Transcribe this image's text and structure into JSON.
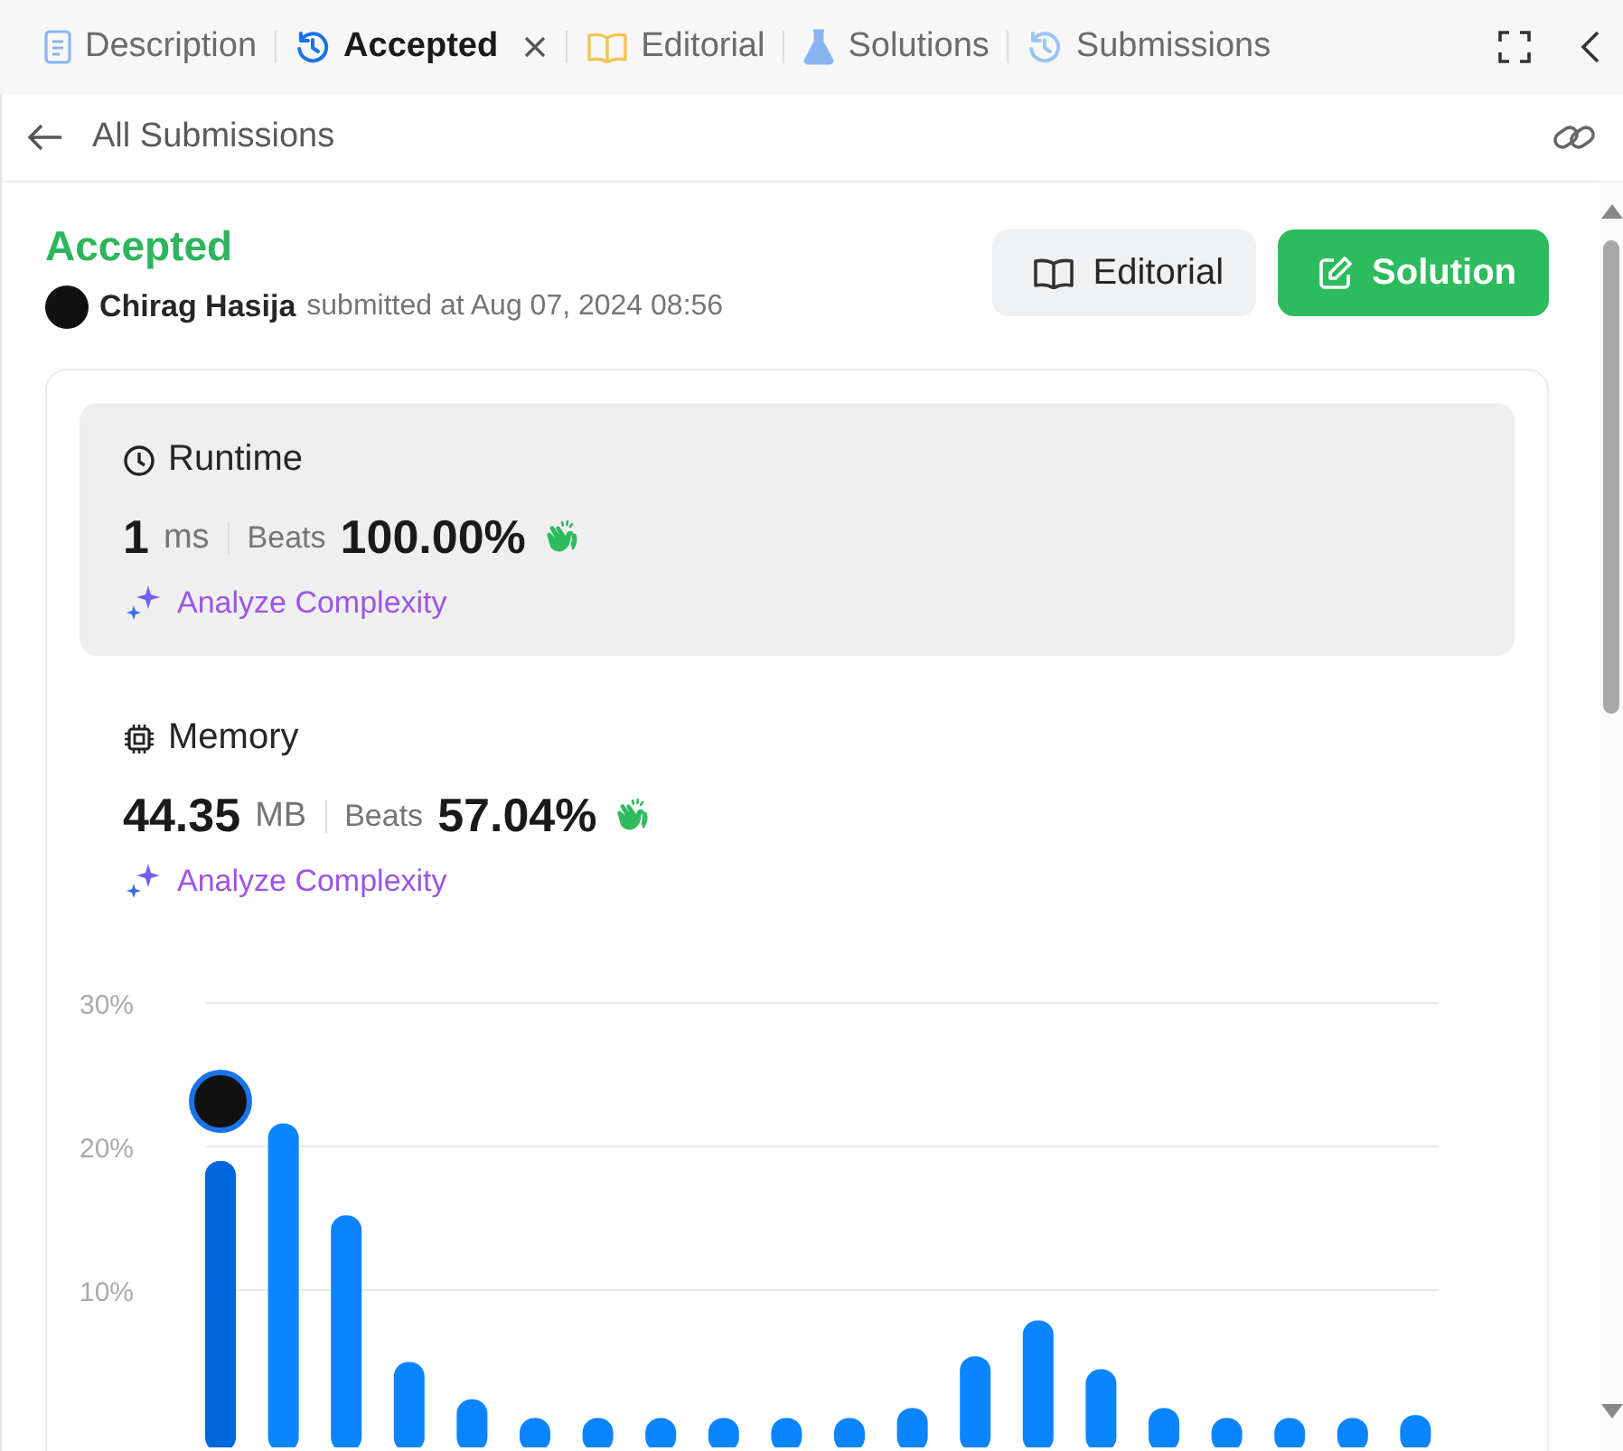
{
  "tabs": [
    {
      "label": "Description",
      "kind": "doc",
      "selected": false,
      "closable": false
    },
    {
      "label": "Accepted",
      "kind": "history",
      "selected": true,
      "closable": true
    },
    {
      "label": "Editorial",
      "kind": "book",
      "selected": false,
      "closable": false
    },
    {
      "label": "Solutions",
      "kind": "flask",
      "selected": false,
      "closable": false
    },
    {
      "label": "Submissions",
      "kind": "history",
      "selected": false,
      "closable": false
    }
  ],
  "back_link": "All Submissions",
  "submission": {
    "status": "Accepted",
    "author": "Chirag Hasija",
    "submitted_text": "submitted at Aug 07, 2024 08:56"
  },
  "buttons": [
    {
      "label": "Editorial",
      "kind": "secondary"
    },
    {
      "label": "Solution",
      "kind": "primary"
    }
  ],
  "metrics": [
    {
      "title": "Runtime",
      "kind": "clock",
      "value": "1",
      "unit": "ms",
      "beats_label": "Beats",
      "beats": "100.00%",
      "analyze": "Analyze Complexity",
      "selected": true
    },
    {
      "title": "Memory",
      "kind": "chip",
      "value": "44.35",
      "unit": "MB",
      "beats_label": "Beats",
      "beats": "57.04%",
      "analyze": "Analyze Complexity",
      "selected": false
    }
  ],
  "distribution": {
    "chart_data": {
      "type": "bar",
      "ylim": [
        0,
        30
      ],
      "yticks": [
        {
          "value": 10,
          "label": "10%"
        },
        {
          "value": 20,
          "label": "20%"
        },
        {
          "value": 30,
          "label": "30%"
        }
      ],
      "series": [
        {
          "color": "#0066dd",
          "values": [
            19.0,
            null,
            null,
            null,
            null,
            null,
            null,
            null,
            null,
            null,
            null,
            null,
            null,
            null,
            null,
            null,
            null,
            null,
            null,
            null
          ]
        },
        {
          "color": "#0a84ff",
          "values": [
            null,
            21.6,
            15.2,
            5.0,
            2.4,
            1.1,
            1.1,
            1.1,
            1.1,
            1.1,
            1.1,
            1.8,
            5.4,
            7.9,
            4.5,
            1.8,
            1.1,
            1.1,
            1.1,
            1.3
          ]
        }
      ]
    }
  }
}
